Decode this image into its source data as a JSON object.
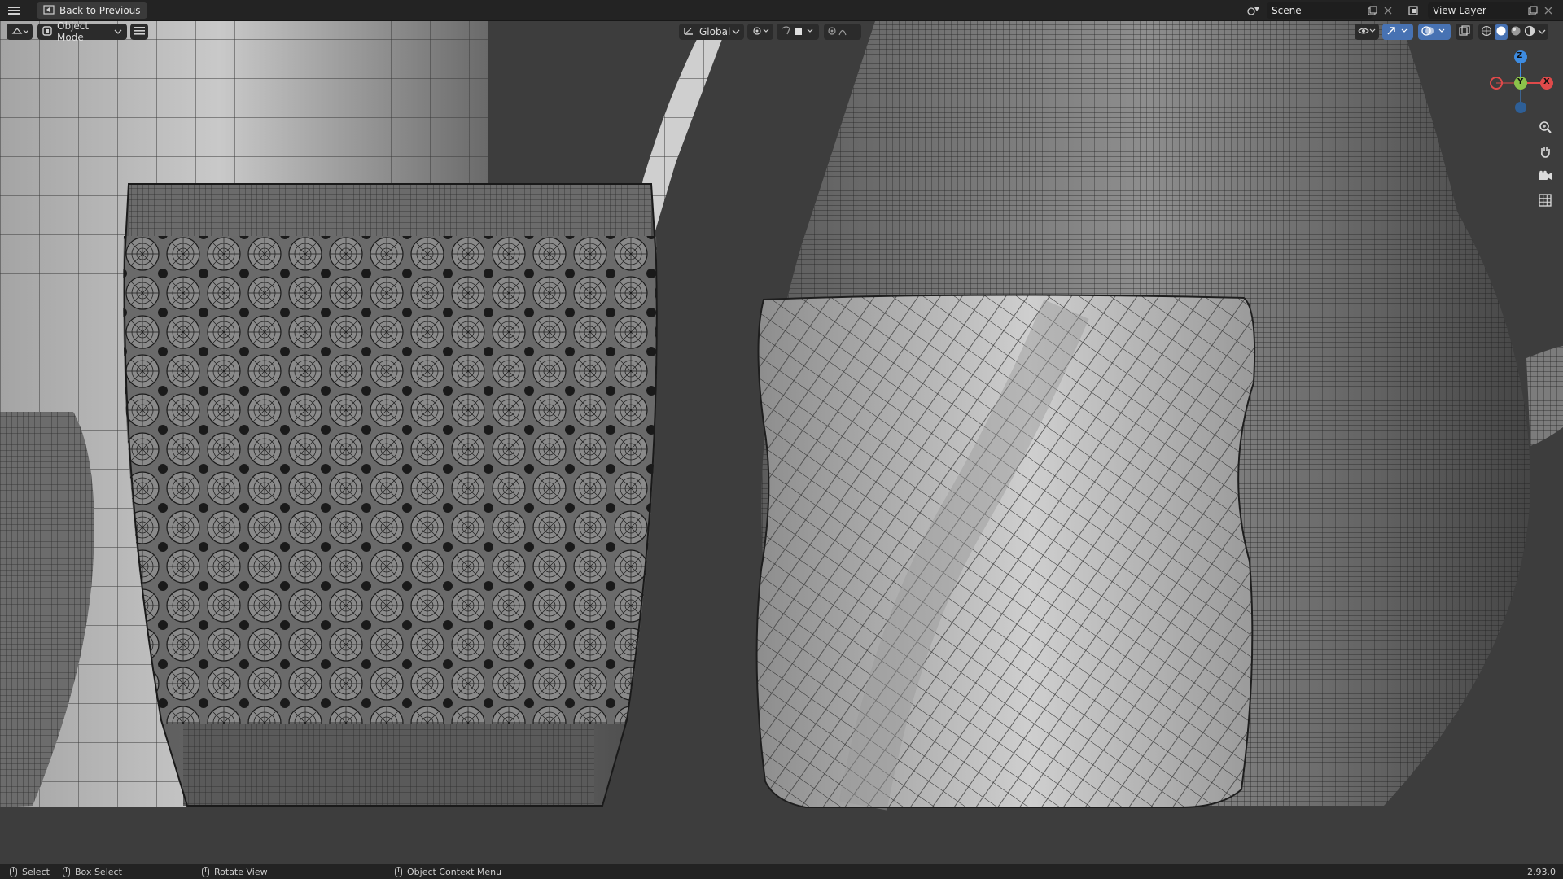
{
  "topbar": {
    "back_label": "Back to Previous",
    "scene_name": "Scene",
    "view_layer_name": "View Layer"
  },
  "header": {
    "mode_label": "Object Mode",
    "transform_orientation": "Global"
  },
  "gizmo": {
    "x_label": "X",
    "y_label": "Y",
    "z_label": "Z"
  },
  "status": {
    "select": "Select",
    "box_select": "Box Select",
    "rotate_view": "Rotate View",
    "context_menu": "Object Context Menu",
    "version": "2.93.0"
  },
  "icons": [
    "menu-icon",
    "back-icon",
    "editor-type-icon",
    "object-mode-icon",
    "hamburger-icon",
    "transform-icon",
    "pivot-icon",
    "snap-icon",
    "proportional-icon",
    "scene-icon",
    "view-layer-icon",
    "zoom-icon",
    "hand-icon",
    "camera-icon",
    "grid-icon",
    "gizmo-icon",
    "overlay-icon",
    "xray-icon",
    "shading-wire-icon",
    "shading-solid-icon",
    "shading-material-icon",
    "shading-rendered-icon"
  ],
  "colors": {
    "gizmo_x": "#e04a4a",
    "gizmo_y": "#8bc34a",
    "gizmo_z": "#3d8be0",
    "accent": "#4772b3"
  }
}
